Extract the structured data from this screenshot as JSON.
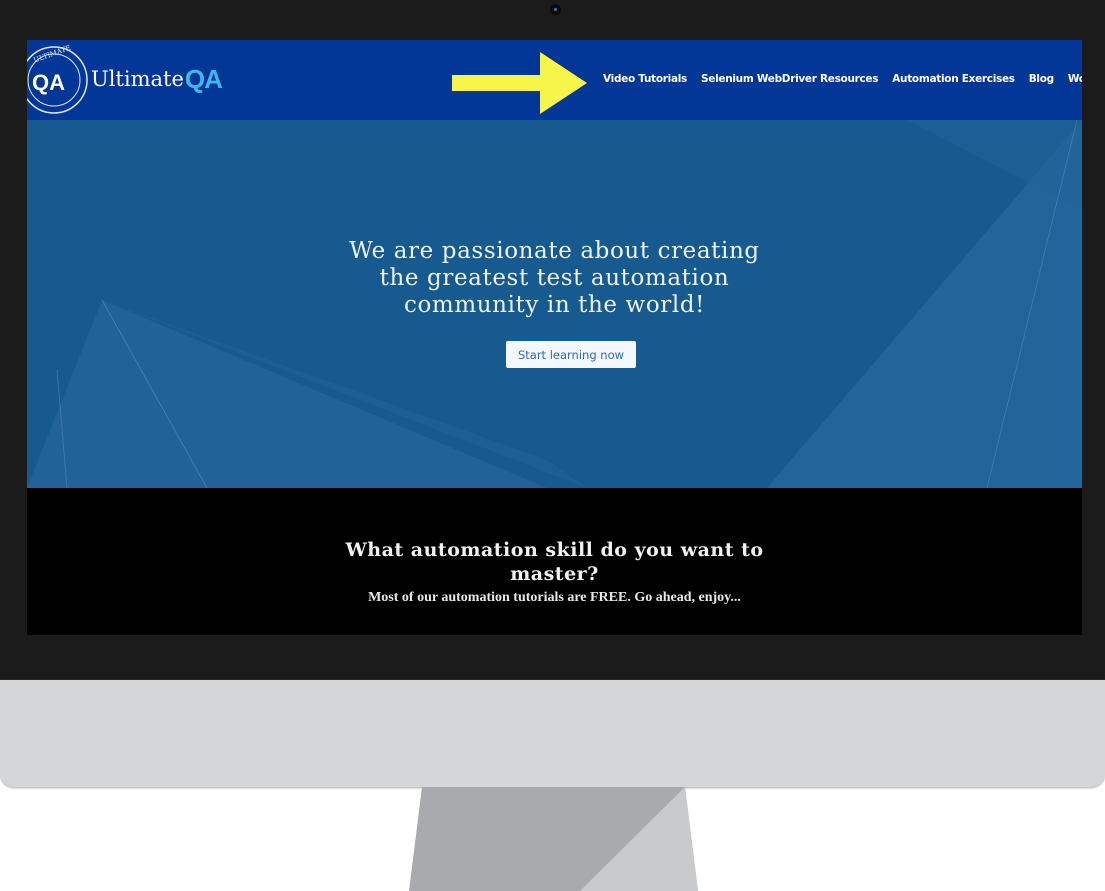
{
  "logo": {
    "seal_text": "ULTIMATE",
    "mark": "QA",
    "name": "Ultimate",
    "name_accent": "QA"
  },
  "nav": {
    "items": [
      "Video Tutorials",
      "Selenium WebDriver Resources",
      "Automation Exercises",
      "Blog",
      "Work w"
    ]
  },
  "hero": {
    "headline_lines": [
      "We are passionate about creating",
      "the greatest test automation",
      "community in the world!"
    ],
    "cta": "Start learning now"
  },
  "skills": {
    "title_lines": [
      "What automation skill do you want to",
      "master?"
    ],
    "subtitle": "Most of our automation tutorials are FREE. Go ahead, enjoy..."
  },
  "colors": {
    "header": "#033797",
    "hero": "#175a8f",
    "accent": "#3fb6ec",
    "arrow": "#f8f54a"
  },
  "icons": {
    "annotation": "arrow-right-icon"
  }
}
